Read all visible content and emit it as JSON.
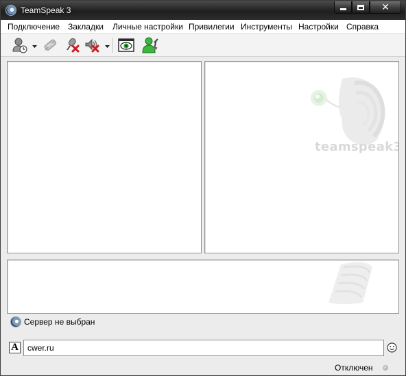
{
  "window": {
    "title": "TeamSpeak 3"
  },
  "menu": {
    "items": [
      "Подключение",
      "Закладки",
      "Личные настройки",
      "Привилегии",
      "Инструменты",
      "Настройки",
      "Справка"
    ]
  },
  "toolbar": {
    "buttons": [
      "connect-icon",
      "disconnect-icon",
      "mute-microphone-icon",
      "mute-speakers-icon",
      "away-status-icon",
      "identity-icon"
    ]
  },
  "info_panel": {
    "logo_text": "teamspeak3"
  },
  "tab": {
    "label": "Сервер не выбран"
  },
  "chat": {
    "input_value": "cwer.ru"
  },
  "status": {
    "text": "Отключен"
  },
  "colors": {
    "titlebar": "#2c2c2c",
    "accent_green": "#3aa83a",
    "disconnected_led": "#b0b0b0"
  }
}
